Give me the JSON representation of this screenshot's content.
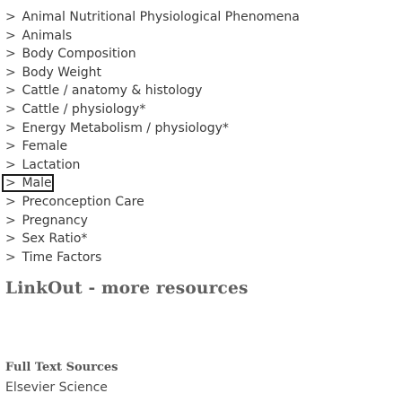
{
  "mesh_terms": {
    "chevron_icon": "chevron-right-icon",
    "items": [
      {
        "label": "Animal Nutritional Physiological Phenomena"
      },
      {
        "label": "Animals"
      },
      {
        "label": "Body Composition"
      },
      {
        "label": "Body Weight"
      },
      {
        "label": "Cattle / anatomy & histology"
      },
      {
        "label": "Cattle / physiology*"
      },
      {
        "label": "Energy Metabolism / physiology*"
      },
      {
        "label": "Female"
      },
      {
        "label": "Lactation"
      },
      {
        "label": "Male",
        "selected": true
      },
      {
        "label": "Preconception Care"
      },
      {
        "label": "Pregnancy"
      },
      {
        "label": "Sex Ratio*"
      },
      {
        "label": "Time Factors"
      }
    ]
  },
  "linkout": {
    "heading": "LinkOut - more resources",
    "full_text_label": "Full Text Sources",
    "providers": [
      "Elsevier Science"
    ]
  }
}
